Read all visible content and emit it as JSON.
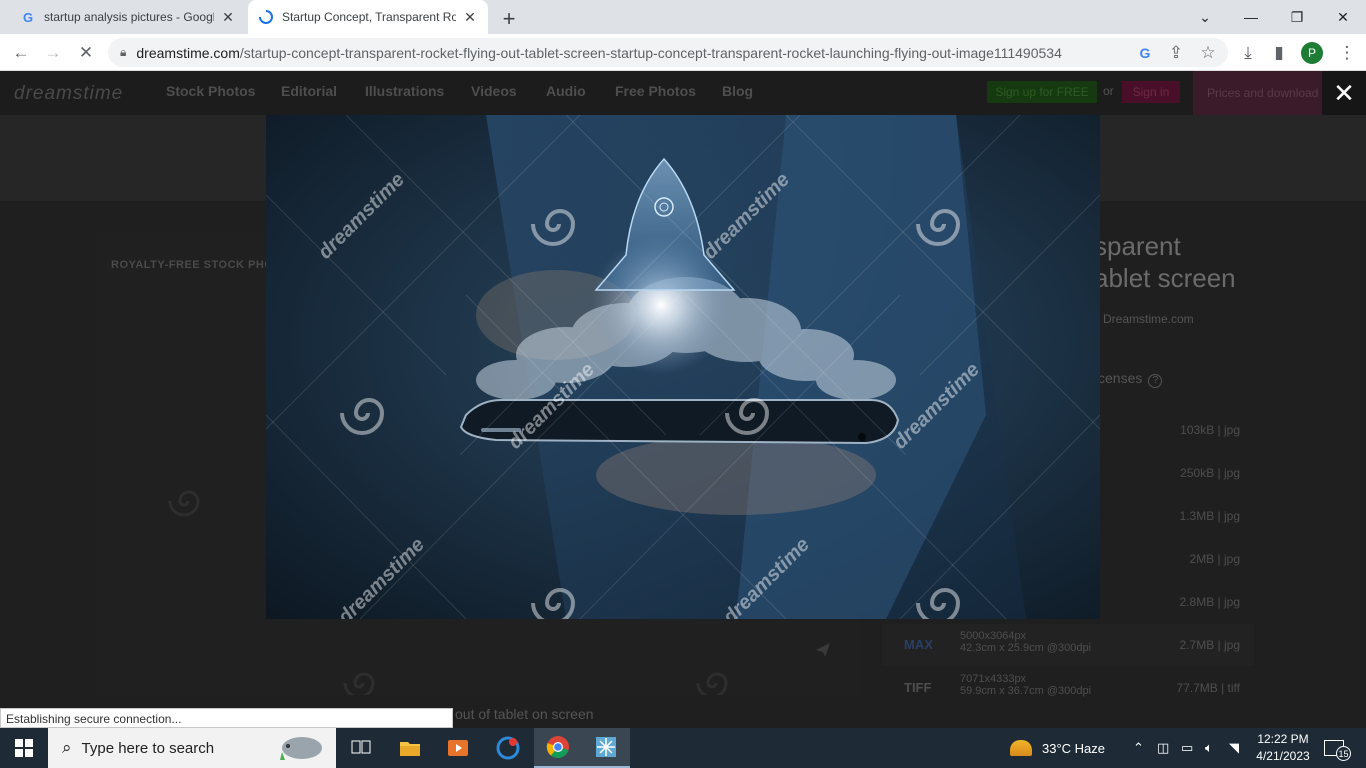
{
  "browser": {
    "tabs": [
      {
        "title": "startup analysis pictures - Google",
        "favicon": "G"
      },
      {
        "title": "Startup Concept, Transparent Roc",
        "favicon": "loading"
      }
    ],
    "url_domain": "dreamstime.com",
    "url_path": "/startup-concept-transparent-rocket-flying-out-tablet-screen-startup-concept-transparent-rocket-launching-flying-out-image111490534",
    "profile_initial": "P",
    "status_text": "Establishing secure connection..."
  },
  "site": {
    "logo": "dreamstime",
    "nav": [
      "Stock Photos",
      "Editorial",
      "Illustrations",
      "Videos",
      "Audio",
      "Free Photos",
      "Blog"
    ],
    "signup_label": "Sign up for FREE",
    "or_label": "or",
    "signin_label": "Sign in",
    "prices_label": "Prices and download",
    "close_symbol": "✕"
  },
  "content": {
    "royalty_label": "ROYALTY-FREE STOCK PHO",
    "title_line1": "sparent",
    "title_line2": "ablet screen",
    "credit": "Dreamstime.com",
    "licenses_label": "censes",
    "sizes": [
      {
        "label": "",
        "dims1": "",
        "dims2": "",
        "size": "103kB | jpg"
      },
      {
        "label": "",
        "dims1": "",
        "dims2": "",
        "size": "250kB | jpg"
      },
      {
        "label": "",
        "dims1": "",
        "dims2": "",
        "size": "1.3MB | jpg"
      },
      {
        "label": "",
        "dims1": "",
        "dims2": "",
        "size": "2MB | jpg"
      },
      {
        "label": "",
        "dims1": "",
        "dims2": "",
        "size": "2.8MB | jpg"
      },
      {
        "label": "MAX",
        "dims1": "5000x3064px",
        "dims2": "42.3cm x 25.9cm @300dpi",
        "size": "2.7MB | jpg"
      },
      {
        "label": "TIFF",
        "dims1": "7071x4333px",
        "dims2": "59.9cm x 36.7cm @300dpi",
        "size": "77.7MB | tiff"
      }
    ],
    "caption": "out of tablet on screen",
    "watermark": "dreamstime"
  },
  "taskbar": {
    "search_placeholder": "Type here to search",
    "weather": "33°C  Haze",
    "time": "12:22 PM",
    "date": "4/21/2023",
    "notification_count": "15"
  },
  "colors": {
    "chrome_tabstrip": "#dee1e6",
    "taskbar": "#1e2b36",
    "profile": "#1e7d34"
  }
}
